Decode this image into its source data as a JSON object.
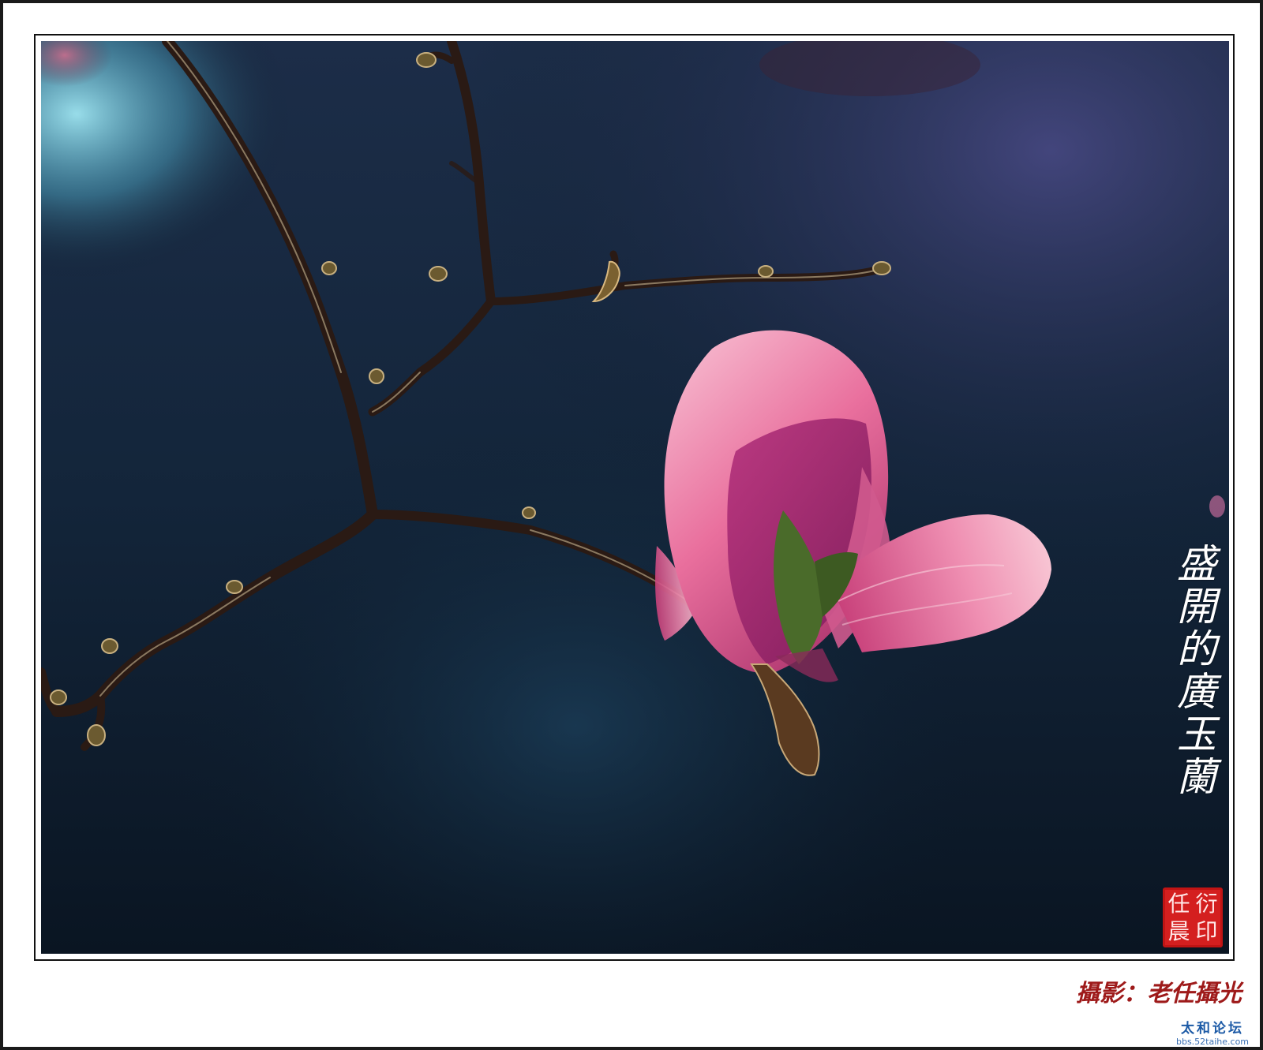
{
  "photo": {
    "subject": "magnolia-blossom-on-branch",
    "colors": {
      "background_dark": "#0d1c2c",
      "background_blue": "#1d3a55",
      "background_purple": "#3a3a6a",
      "highlight_cyan": "#7fd4e6",
      "petal_pink": "#e86a9a",
      "petal_light": "#f4a8c2",
      "petal_shadow": "#a03070",
      "branch": "#2a1a14",
      "leaf_green": "#4a6b2a"
    }
  },
  "title": {
    "text": "盛開的廣玉蘭"
  },
  "seal": {
    "text": "任晨衍印",
    "chars": [
      "任",
      "衍",
      "晨",
      "印"
    ],
    "color": "#d41f1f"
  },
  "credit": {
    "text": "攝影：老任攝光"
  },
  "watermark": {
    "name": "太和论坛",
    "url": "bbs.52taihe.com",
    "color": "#1c5aa6"
  }
}
